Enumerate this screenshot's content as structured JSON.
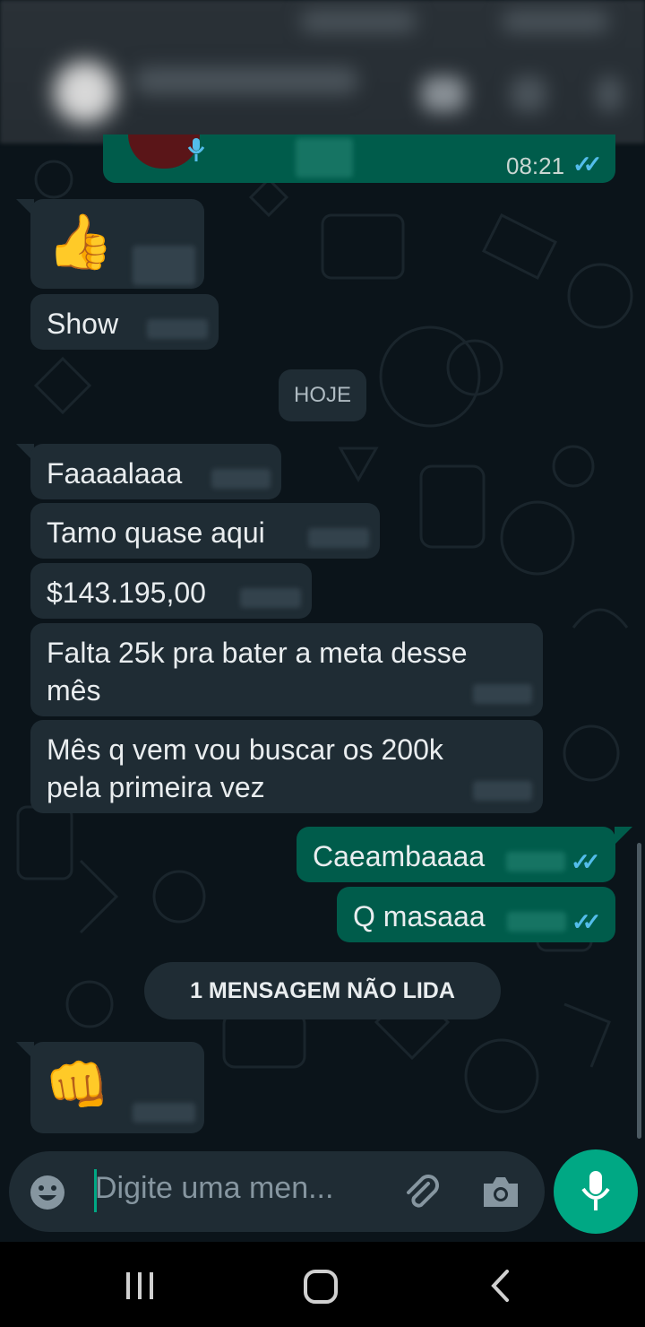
{
  "colors": {
    "background": "#0b141a",
    "incoming_bubble": "#1f2c34",
    "outgoing_bubble": "#005c4b",
    "read_ticks": "#53bdeb",
    "accent": "#00a884"
  },
  "top_message": {
    "time": "08:21",
    "status": "read",
    "icon": "mic-icon"
  },
  "messages_before": [
    {
      "emoji": "👍",
      "direction": "incoming"
    },
    {
      "text": "Show",
      "direction": "incoming"
    }
  ],
  "date_chip": "HOJE",
  "messages_today": [
    {
      "text": "Faaaalaaa",
      "direction": "incoming"
    },
    {
      "text": "Tamo quase aqui",
      "direction": "incoming"
    },
    {
      "text": "$143.195,00",
      "direction": "incoming"
    },
    {
      "text": "Falta 25k pra bater a meta desse mês",
      "direction": "incoming"
    },
    {
      "text": "Mês q vem vou buscar os 200k pela primeira vez",
      "direction": "incoming"
    },
    {
      "text": "Caeambaaaa",
      "direction": "outgoing",
      "status": "read"
    },
    {
      "text": "Q masaaa",
      "direction": "outgoing",
      "status": "read"
    }
  ],
  "unread_banner": "1 MENSAGEM NÃO LIDA",
  "last_message": {
    "emoji": "👊",
    "direction": "incoming"
  },
  "composer": {
    "placeholder": "Digite uma men...",
    "icons": [
      "emoji-icon",
      "attach-icon",
      "camera-icon",
      "mic-icon"
    ]
  },
  "navbar": {
    "icons": [
      "recents-icon",
      "home-icon",
      "back-icon"
    ]
  }
}
